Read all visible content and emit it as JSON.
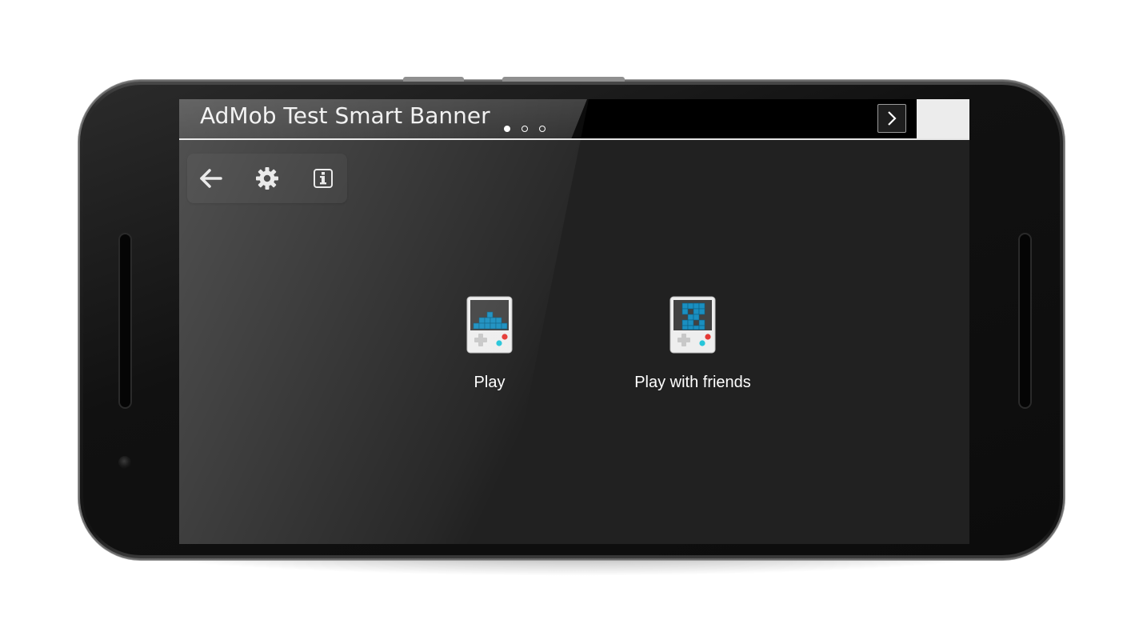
{
  "ad_banner": {
    "title": "AdMob Test Smart Banner",
    "page_count": 3,
    "active_page": 0,
    "next_icon": "chevron-right-icon"
  },
  "toolbar": {
    "items": [
      {
        "icon": "arrow-left-icon",
        "name": "back"
      },
      {
        "icon": "gear-icon",
        "name": "settings"
      },
      {
        "icon": "info-icon",
        "name": "info"
      }
    ]
  },
  "menu": {
    "play_label": "Play",
    "play_friends_label": "Play with friends"
  },
  "colors": {
    "screen_bg": "#212121",
    "block": "#1a8fc0",
    "button_red": "#e53935",
    "button_cyan": "#26c6da"
  }
}
